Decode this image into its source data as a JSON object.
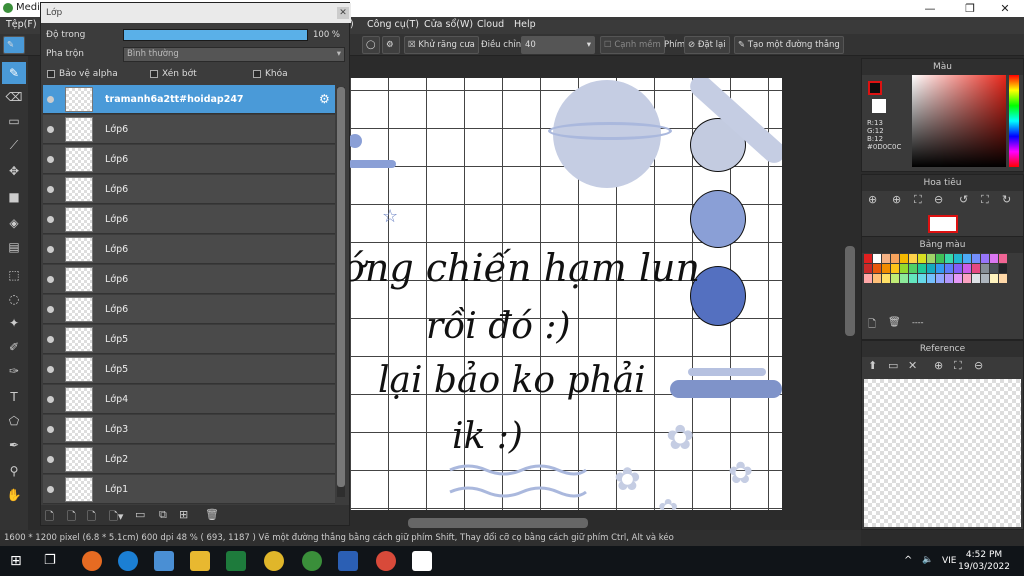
{
  "window": {
    "title": "Medil",
    "minimize": "—",
    "maximize": "❐",
    "close": "✕"
  },
  "menu": [
    "Tệp(F)",
    ")",
    "Công cụ(T)",
    "Cửa sổ(W)",
    "Cloud",
    "Help"
  ],
  "toolbar": {
    "antialias": "Khử răng cưa",
    "adjust": "Điều chỉnh",
    "adjust_value": "40",
    "edge": "Cạnh mềm",
    "key": "Phím",
    "reset": "Đặt lại",
    "straight_line": "Tạo một đường thẳng"
  },
  "layer_panel": {
    "title": "Lớp",
    "opacity_label": "Độ trong",
    "opacity_value": "100 %",
    "opacity": 1.0,
    "blend_label": "Pha trộn",
    "blend_value": "Bình thường",
    "protect_alpha": "Bảo vệ alpha",
    "clip": "Xén bớt",
    "lock": "Khóa",
    "layers": [
      "tramanh6a2tt#hoidap247",
      "Lớp6",
      "Lớp6",
      "Lớp6",
      "Lớp6",
      "Lớp6",
      "Lớp6",
      "Lớp6",
      "Lớp5",
      "Lớp5",
      "Lớp4",
      "Lớp3",
      "Lớp2",
      "Lớp1"
    ]
  },
  "canvas_text": [
    "ớng chiến hạm lun",
    "rồi đó :)",
    "lại bảo ko phải",
    "ik :)"
  ],
  "right": {
    "color_title": "Màu",
    "rgb": [
      "R:13",
      "G:12",
      "B:12",
      "#0D0C0C"
    ],
    "navigator_title": "Hoa tiêu",
    "palette_title": "Bảng màu",
    "palette_dash": "----",
    "reference_title": "Reference"
  },
  "status": "1600 * 1200 pixel   (6.8 * 5.1cm)   600 dpi   48 %   ( 693, 1187 )   Vẽ một đường thẳng bằng cách giữ phím Shift, Thay đổi cỡ cọ bằng cách giữ phím Ctrl, Alt và kéo",
  "taskbar": {
    "lang": "VIE",
    "time": "4:52 PM",
    "date": "19/03/2022"
  },
  "colors": {
    "accent": "#4a9ad8",
    "shapes": "#7d92c9"
  }
}
